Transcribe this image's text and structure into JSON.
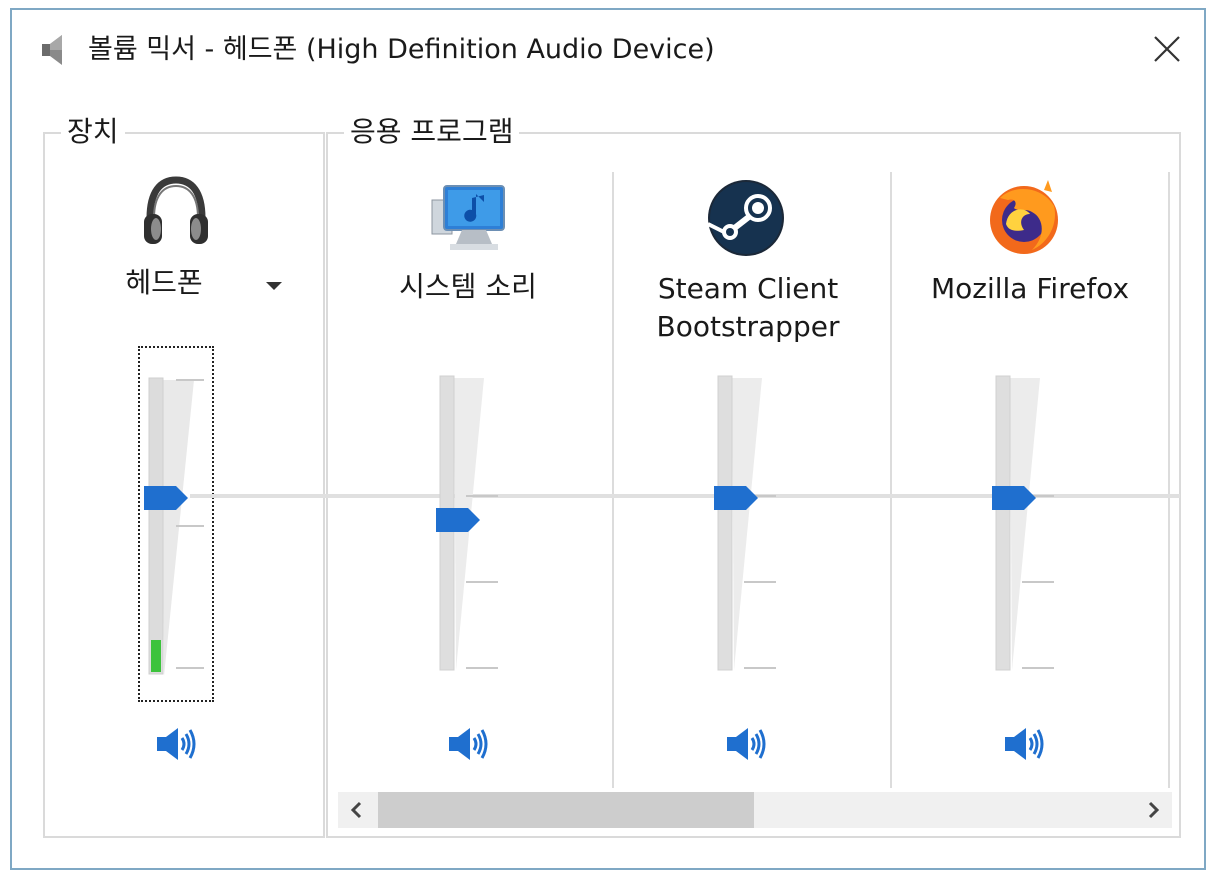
{
  "window": {
    "title": "볼륨 믹서 - 헤드폰 (High Definition Audio Device)"
  },
  "device_section": {
    "label": "장치",
    "device": {
      "name": "헤드폰",
      "icon": "headphones-icon",
      "volume_fraction": 0.6,
      "peak_meter_fraction": 0.11
    }
  },
  "apps_section": {
    "label": "응용 프로그램",
    "apps": [
      {
        "name": "시스템 소리",
        "icon": "system-sounds-icon",
        "volume_fraction": 0.52
      },
      {
        "name_line1": "Steam Client",
        "name_line2": "Bootstrapper",
        "icon": "steam-icon",
        "volume_fraction": 0.6
      },
      {
        "name": "Mozilla Firefox",
        "icon": "firefox-icon",
        "volume_fraction": 0.6
      }
    ]
  },
  "scrollbar": {
    "thumb_fraction": 0.45,
    "position_fraction": 0.0
  },
  "colors": {
    "accent": "#1f6fcf",
    "meter_green": "#3cc33c",
    "track": "#e3e3e3",
    "window_border": "#7fa8c4"
  }
}
